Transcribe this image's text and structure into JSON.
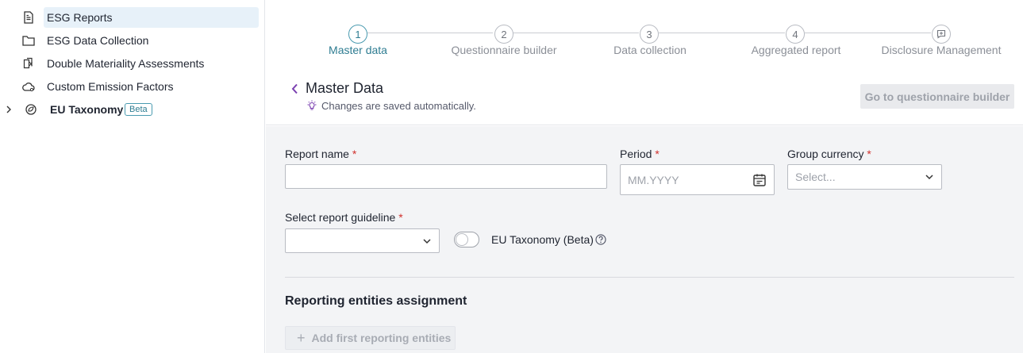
{
  "sidebar": {
    "items": [
      {
        "label": "ESG Reports",
        "icon": "document-icon",
        "active": true
      },
      {
        "label": "ESG Data Collection",
        "icon": "folder-icon"
      },
      {
        "label": "Double Materiality Assessments",
        "icon": "files-icon"
      },
      {
        "label": "Custom Emission Factors",
        "icon": "cloud-icon"
      },
      {
        "label": "EU Taxonomy",
        "icon": "leaf-globe-icon",
        "badge": "Beta",
        "expandable": true
      }
    ]
  },
  "stepper": {
    "steps": [
      {
        "number": "1",
        "label": "Master data",
        "active": true
      },
      {
        "number": "2",
        "label": "Questionnaire builder"
      },
      {
        "number": "3",
        "label": "Data collection"
      },
      {
        "number": "4",
        "label": "Aggregated report"
      },
      {
        "number": "",
        "label": "Disclosure Management",
        "icon": "comment-icon"
      }
    ]
  },
  "header": {
    "title": "Master Data",
    "autosave_text": "Changes are saved automatically.",
    "goto_button": "Go to questionnaire builder"
  },
  "form": {
    "report_name": {
      "label": "Report name",
      "required": "*",
      "value": ""
    },
    "period": {
      "label": "Period",
      "required": "*",
      "placeholder": "MM.YYYY"
    },
    "group_currency": {
      "label": "Group currency",
      "required": "*",
      "placeholder": "Select..."
    },
    "guideline": {
      "label": "Select report guideline",
      "required": "*",
      "value": ""
    },
    "eu_taxonomy_toggle": {
      "label": "EU Taxonomy (Beta)",
      "on": false
    }
  },
  "entities": {
    "title": "Reporting entities assignment",
    "add_button": "Add first reporting entities"
  },
  "colors": {
    "accent": "#2f7d92",
    "back_chevron": "#7a3fb0",
    "required": "#d0312d",
    "active_nav_bg": "#e7f1f9"
  }
}
